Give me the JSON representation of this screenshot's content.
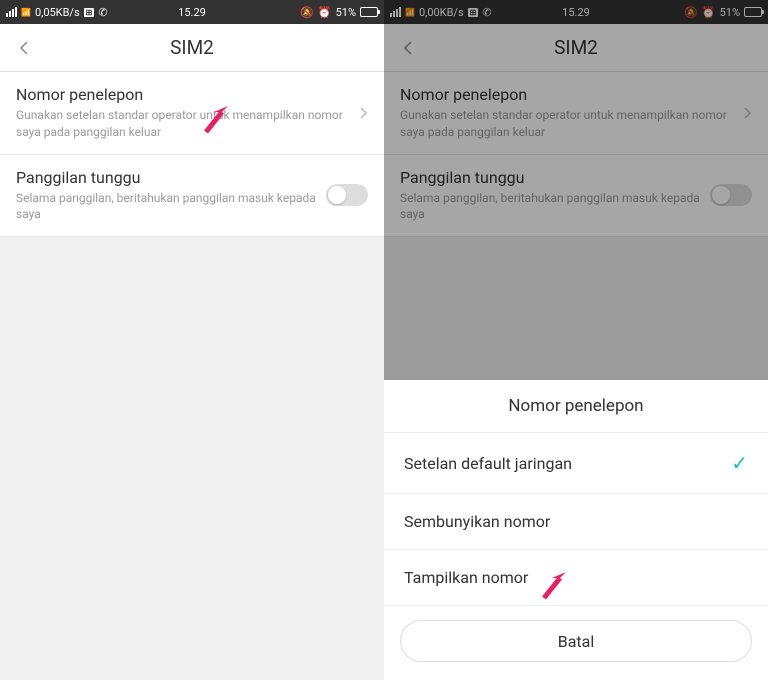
{
  "statusbar": {
    "speed1": "0,05KB/s",
    "speed2": "0,00KB/s",
    "time": "15.29",
    "battery_pct": "51%"
  },
  "header": {
    "title": "SIM2"
  },
  "settings": {
    "caller_id": {
      "title": "Nomor penelepon",
      "subtitle": "Gunakan setelan standar operator untuk menampilkan nomor saya pada panggilan keluar"
    },
    "call_waiting": {
      "title": "Panggilan tunggu",
      "subtitle": "Selama panggilan, beritahukan panggilan masuk kepada saya"
    }
  },
  "sheet": {
    "title": "Nomor penelepon",
    "options": {
      "default": "Setelan default jaringan",
      "hide": "Sembunyikan nomor",
      "show": "Tampilkan nomor"
    },
    "cancel": "Batal"
  }
}
